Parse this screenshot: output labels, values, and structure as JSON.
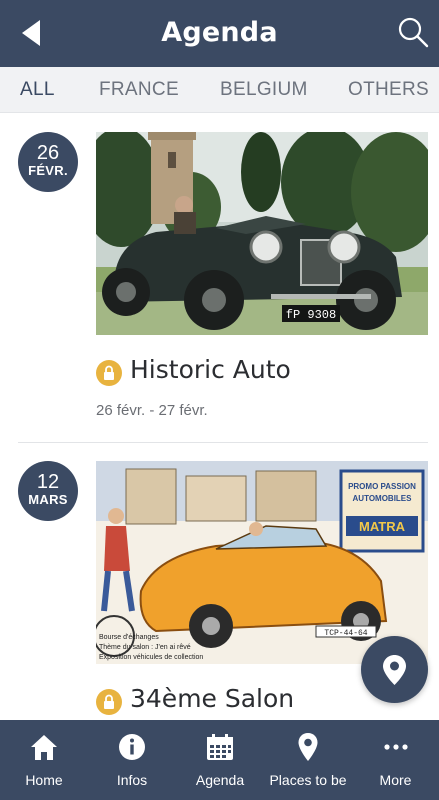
{
  "header": {
    "title": "Agenda",
    "back_icon": "back-arrow-icon",
    "search_icon": "search-icon"
  },
  "tabs": [
    {
      "label": "ALL",
      "active": true
    },
    {
      "label": "FRANCE",
      "active": false
    },
    {
      "label": "BELGIUM",
      "active": false
    },
    {
      "label": "OTHERS",
      "active": false
    }
  ],
  "events": [
    {
      "day": "26",
      "month": "FÉVR.",
      "title": "Historic Auto",
      "dates": "26 févr. - 27 févr.",
      "image_plate": "fP 9308",
      "icon": "lock-icon"
    },
    {
      "day": "12",
      "month": "MARS",
      "title": "34ème Salon",
      "image_banner": [
        "PROMO PASSION",
        "AUTOMOBILES",
        "MATRA"
      ],
      "image_plate": "TCP-44-64",
      "image_caption": [
        "Bourse d'échanges",
        "Thème du salon : J'en ai rêvé",
        "Exposition véhicules de collection"
      ],
      "icon": "lock-icon"
    }
  ],
  "fab": {
    "icon": "map-pin-icon"
  },
  "bottom_nav": [
    {
      "label": "Home",
      "icon": "home-icon"
    },
    {
      "label": "Infos",
      "icon": "info-icon"
    },
    {
      "label": "Agenda",
      "icon": "calendar-icon"
    },
    {
      "label": "Places to be",
      "icon": "map-pin-icon"
    },
    {
      "label": "More",
      "icon": "more-dots-icon"
    }
  ],
  "colors": {
    "primary": "#3b4a63",
    "tab_bar": "#f1f2f4",
    "accent_lock": "#e8b33f"
  }
}
